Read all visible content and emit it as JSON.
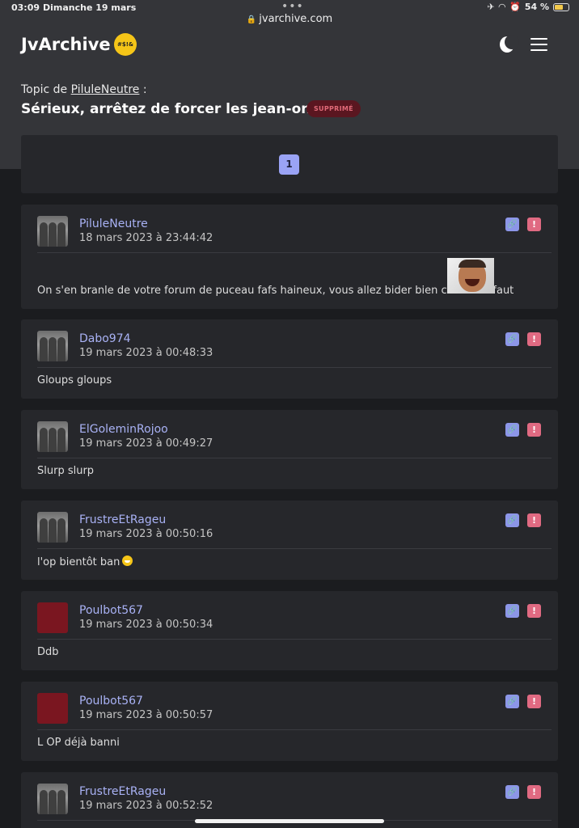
{
  "status_bar": {
    "time": "03:09",
    "date": "Dimanche 19 mars",
    "url": "jvarchive.com",
    "battery": "54 %",
    "battery_level": 0.54
  },
  "header": {
    "logo": "JvArchive",
    "logo_emoji_text": "#$!&",
    "icons": [
      "moon-icon",
      "menu-icon"
    ]
  },
  "topic": {
    "prefix": "Topic de",
    "author": "PiluleNeutre",
    "suffix": " :",
    "title": "Sérieux, arrêtez de forcer les jean-onches",
    "badge": "SUPPRIMÉ"
  },
  "pagination": {
    "current_page": "1"
  },
  "colors": {
    "accent": "#9aa3f5",
    "username": "#a9b2f5",
    "report": "#e06a82",
    "badge_bg": "#5a1620"
  },
  "posts": [
    {
      "username": "PiluleNeutre",
      "timestamp": "18 mars 2023 à 23:44:42",
      "text": "On s'en branle de votre forum de puceau fafs haineux, vous allez bider bien comme il faut",
      "avatar": "photo"
    },
    {
      "username": "Dabo974",
      "timestamp": "19 mars 2023 à 00:48:33",
      "text": "Gloups gloups",
      "avatar": "photo"
    },
    {
      "username": "ElGoleminRojoo",
      "timestamp": "19 mars 2023 à 00:49:27",
      "text": "Slurp slurp",
      "avatar": "photo"
    },
    {
      "username": "FrustreEtRageu",
      "timestamp": "19 mars 2023 à 00:50:16",
      "text": "l'op bientôt ban",
      "avatar": "photo"
    },
    {
      "username": "Poulbot567",
      "timestamp": "19 mars 2023 à 00:50:34",
      "text": "Ddb",
      "avatar": "red"
    },
    {
      "username": "Poulbot567",
      "timestamp": "19 mars 2023 à 00:50:57",
      "text": "L OP déjà banni",
      "avatar": "red"
    },
    {
      "username": "FrustreEtRageu",
      "timestamp": "19 mars 2023 à 00:52:52",
      "text": "",
      "avatar": "photo"
    }
  ]
}
